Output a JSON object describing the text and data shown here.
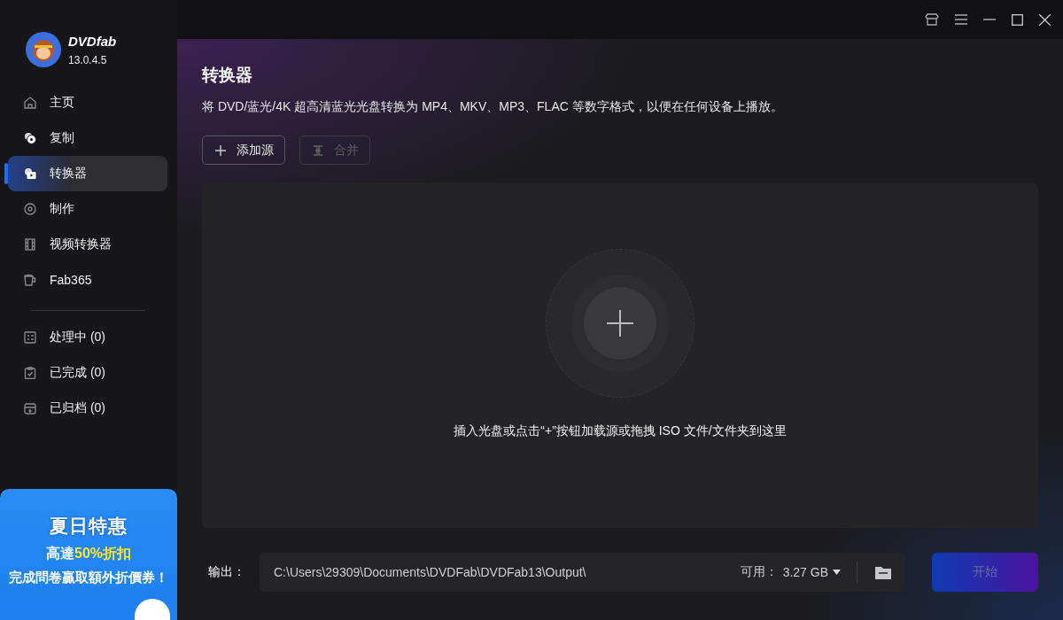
{
  "app": {
    "name": "DVDfab",
    "version": "13.0.4.5"
  },
  "sidebar": {
    "items": [
      {
        "kind": "home",
        "label": "主页",
        "selected": false
      },
      {
        "kind": "copy",
        "label": "复制",
        "selected": false
      },
      {
        "kind": "convert",
        "label": "转换器",
        "selected": true
      },
      {
        "kind": "create",
        "label": "制作",
        "selected": false
      },
      {
        "kind": "video",
        "label": "视频转换器",
        "selected": false
      },
      {
        "kind": "fab",
        "label": "Fab365",
        "selected": false
      }
    ],
    "queue": [
      {
        "kind": "processing",
        "label": "处理中 (0)"
      },
      {
        "kind": "done",
        "label": "已完成 (0)"
      },
      {
        "kind": "archive",
        "label": "已归档 (0)"
      }
    ]
  },
  "promo": {
    "title": "夏日特惠",
    "line1": "高達",
    "highlight": "50%折扣",
    "line2": "完成問卷贏取額外折價券！"
  },
  "page": {
    "title": "转换器",
    "description": "将 DVD/蓝光/4K 超高清蓝光光盘转换为 MP4、MKV、MP3、FLAC 等数字格式，以便在任何设备上播放。",
    "buttons": [
      {
        "kind": "add",
        "label": "添加源",
        "disabled": false
      },
      {
        "kind": "merge",
        "label": "合并",
        "disabled": true
      }
    ],
    "drop_hint": "插入光盘或点击“+”按钮加载源或拖拽 ISO 文件/文件夹到这里"
  },
  "output": {
    "label": "输出：",
    "path": "C:\\Users\\29309\\Documents\\DVDFab\\DVDFab13\\Output\\",
    "free_label": "可用：",
    "free_value": "3.27 GB",
    "start": {
      "label": "开始",
      "disabled": true
    }
  }
}
